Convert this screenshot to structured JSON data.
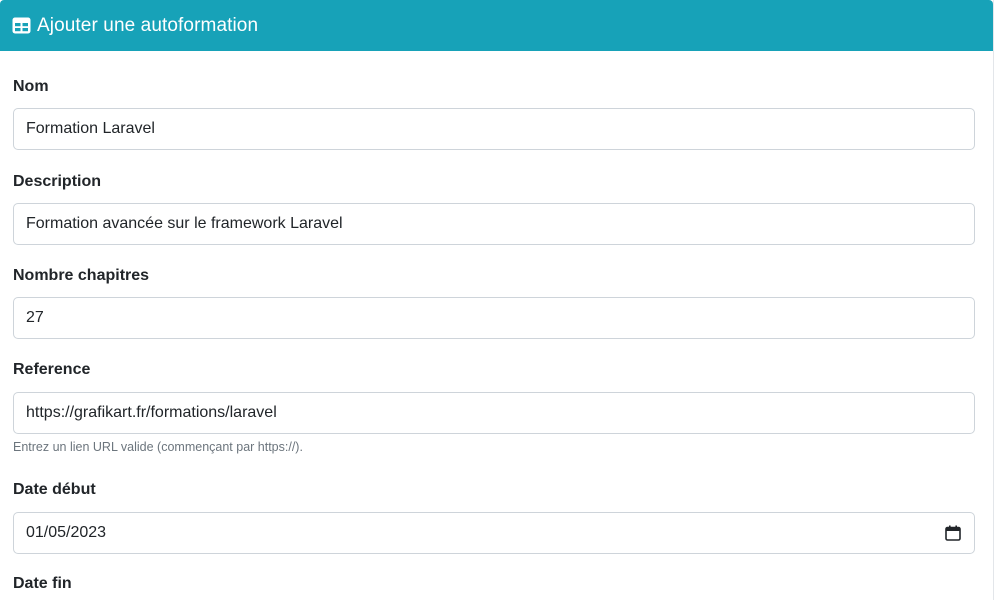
{
  "header": {
    "title": "Ajouter une autoformation",
    "icon": "table-icon",
    "background": "#17a2b8"
  },
  "form": {
    "nom": {
      "label": "Nom",
      "value": "Formation Laravel"
    },
    "description": {
      "label": "Description",
      "value": "Formation avancée sur le framework Laravel"
    },
    "nombre_chapitres": {
      "label": "Nombre chapitres",
      "value": "27"
    },
    "reference": {
      "label": "Reference",
      "value": "https://grafikart.fr/formations/laravel",
      "help": "Entrez un lien URL valide (commençant par https://)."
    },
    "date_debut": {
      "label": "Date début",
      "value": "01/05/2023",
      "icon": "calendar-icon"
    },
    "date_fin": {
      "label": "Date fin"
    }
  }
}
